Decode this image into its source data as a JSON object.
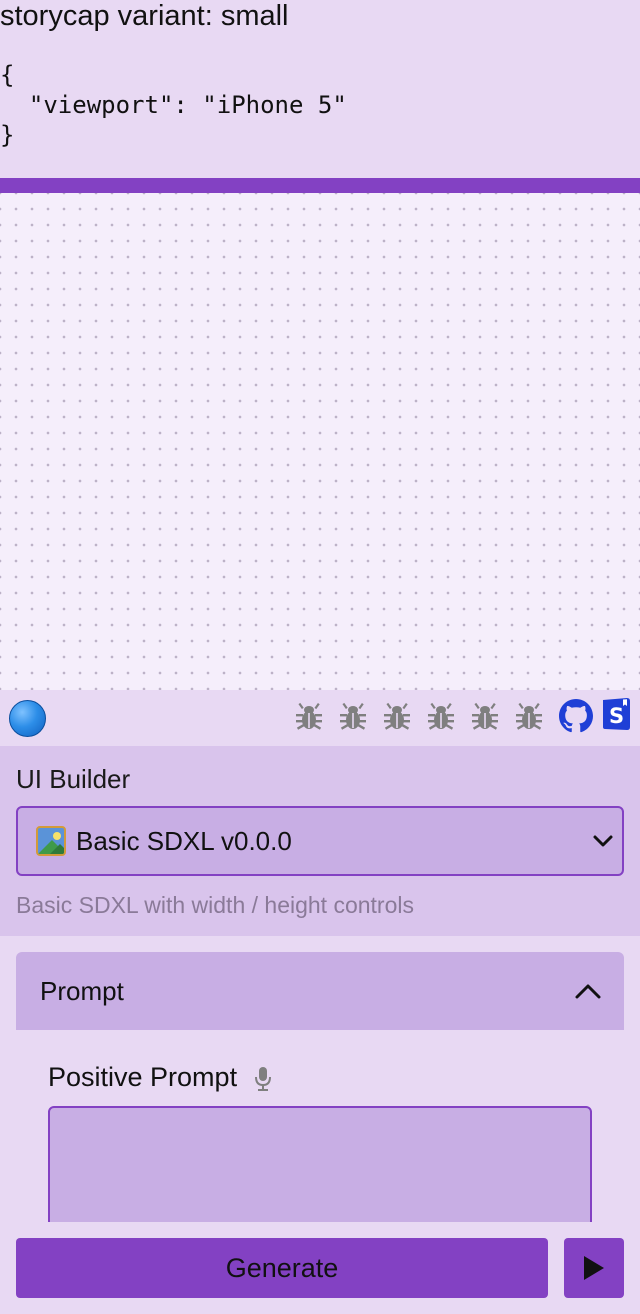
{
  "variant": {
    "title": "storycap variant: small",
    "code": "{\n  \"viewport\": \"iPhone 5\"\n}"
  },
  "toolbar": {
    "status_icon": "blue-circle-icon",
    "debug_icons": [
      "bug-icon",
      "bug-icon",
      "bug-icon",
      "bug-icon",
      "bug-icon",
      "bug-icon"
    ],
    "github_icon": "github-icon",
    "storybook_icon": "storybook-icon"
  },
  "builder": {
    "label": "UI Builder",
    "selected": "Basic SDXL v0.0.0",
    "selected_emoji": "framed-picture-icon",
    "description": "Basic SDXL with width / height controls"
  },
  "prompt_section": {
    "title": "Prompt",
    "positive_label": "Positive Prompt",
    "positive_value": ""
  },
  "actions": {
    "generate_label": "Generate",
    "play_icon": "play-icon"
  },
  "colors": {
    "accent": "#8341c3",
    "background": "#e8d9f3",
    "panel": "#c8aee4"
  }
}
